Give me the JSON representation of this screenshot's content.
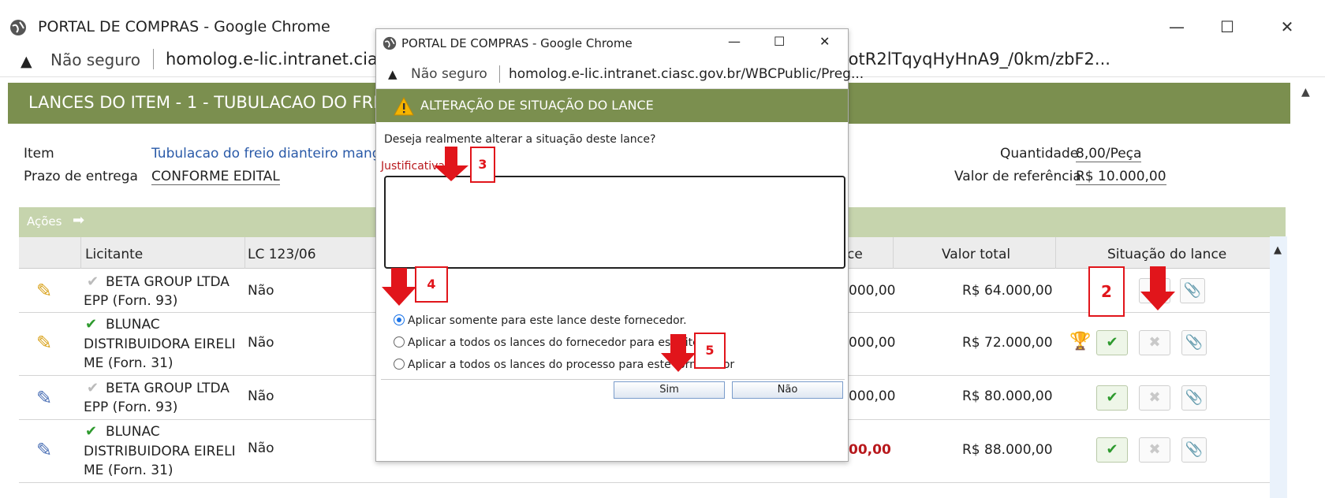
{
  "main_window": {
    "title": "PORTAL DE COMPRAS - Google Chrome",
    "not_secure": "Não seguro",
    "url": "homolog.e-lic.intranet.ciasc.gov.br/WBCPublic/PregaoLancePesquisa.aspx?q=e_8ZotR2lTqyqHyHnA9_/0km/zbF2...",
    "controls": {
      "minimize": "—",
      "maximize": "☐",
      "close": "✕"
    }
  },
  "page": {
    "header": "LANCES DO ITEM - 1 - TUBULACAO DO FREIO DIANTEIRO",
    "item_label": "Item",
    "item_value": "Tubulacao do freio dianteiro mangueira",
    "prazo_label": "Prazo de entrega",
    "prazo_value": "CONFORME EDITAL",
    "quantidade_label": "Quantidade",
    "quantidade_value": "8,00/Peça",
    "valor_ref_label": "Valor de referência",
    "valor_ref_value": "R$ 10.000,00",
    "acoes_label": "Ações"
  },
  "table": {
    "headers": {
      "licitante": "Licitante",
      "lc": "LC 123/06",
      "valor_unit_suffix": "ce",
      "valor_total": "Valor total",
      "situacao": "Situação do lance"
    },
    "rows": [
      {
        "lic_name": "BETA GROUP LTDA",
        "lic_sub": "EPP (Forn. 93)",
        "lc": "Não",
        "unit_partial": "000,00",
        "total": "R$ 64.000,00",
        "valid": false
      },
      {
        "lic_name": "BLUNAC",
        "lic_sub": "DISTRIBUIDORA EIRELI",
        "lic_sub2": "ME (Forn. 31)",
        "lc": "Não",
        "unit_partial": "000,00",
        "total": "R$ 72.000,00",
        "valid": true
      },
      {
        "lic_name": "BETA GROUP LTDA",
        "lic_sub": "EPP (Forn. 93)",
        "lc": "Não",
        "unit_partial": "000,00",
        "total": "R$ 80.000,00",
        "valid": false
      },
      {
        "lic_name": "BLUNAC",
        "lic_sub": "DISTRIBUIDORA EIRELI",
        "lic_sub2": "ME (Forn. 31)",
        "lc": "Não",
        "unit_partial": "00,00",
        "total": "R$ 88.000,00",
        "valid": true
      }
    ]
  },
  "popup": {
    "title": "PORTAL DE COMPRAS - Google Chrome",
    "not_secure": "Não seguro",
    "url": "homolog.e-lic.intranet.ciasc.gov.br/WBCPublic/Preg...",
    "controls": {
      "minimize": "—",
      "maximize": "☐",
      "close": "✕"
    },
    "header": "ALTERAÇÃO DE SITUAÇÃO DO LANCE",
    "question": "Deseja realmente alterar a situação deste lance?",
    "justificativa_label": "Justificativa",
    "radio1": "Aplicar somente para este lance deste fornecedor.",
    "radio2": "Aplicar a todos os lances do fornecedor para este item",
    "radio3": "Aplicar a todos os lances do processo para este fornecedor",
    "btn_sim": "Sim",
    "btn_nao": "Não"
  },
  "annotations": {
    "step2": "2",
    "step3": "3",
    "step4": "4",
    "step5": "5"
  },
  "colors": {
    "header_green": "#7b8f4f",
    "actions_green": "#c6d4ad",
    "annotation_red": "#e1151b",
    "link_blue": "#2a5aa8"
  }
}
